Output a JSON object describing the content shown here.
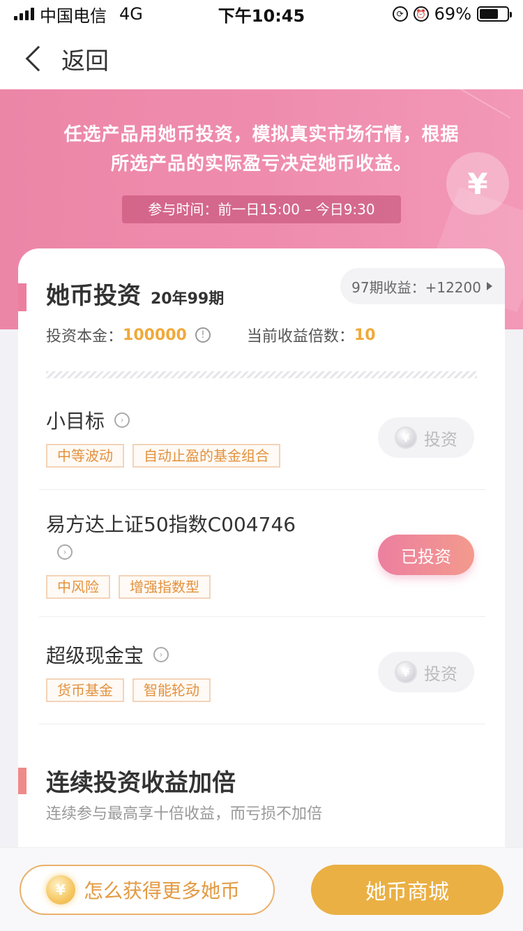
{
  "status_bar": {
    "carrier": "中国电信",
    "network": "4G",
    "time": "下午10:45",
    "battery": "69%",
    "battery_level": 0.69
  },
  "nav": {
    "back_label": "返回"
  },
  "banner": {
    "line1": "任选产品用她币投资，模拟真实市场行情，根据",
    "line2": "所选产品的实际盈亏决定她币收益。",
    "time_label": "参与时间：前一日15:00 – 今日9:30",
    "coin_symbol": "¥"
  },
  "card": {
    "title": "她币投资",
    "period": "20年99期",
    "earnings_pill": "97期收益：+12200",
    "principal_label": "投资本金：",
    "principal_value": "100000",
    "multiplier_label": "当前收益倍数：",
    "multiplier_value": "10"
  },
  "products": [
    {
      "name": "小目标",
      "tags": [
        "中等波动",
        "自动止盈的基金组合"
      ],
      "button": "投资",
      "invested": false
    },
    {
      "name": "易方达上证50指数C004746",
      "tags": [
        "中风险",
        "增强指数型"
      ],
      "button": "已投资",
      "invested": true
    },
    {
      "name": "超级现金宝",
      "tags": [
        "货币基金",
        "智能轮动"
      ],
      "button": "投资",
      "invested": false
    }
  ],
  "section2": {
    "title": "连续投资收益加倍",
    "subtitle": "连续参与最高享十倍收益，而亏损不加倍"
  },
  "bottom": {
    "earn_more_label": "怎么获得更多她币",
    "mall_label": "她币商城",
    "coin_symbol": "¥"
  }
}
